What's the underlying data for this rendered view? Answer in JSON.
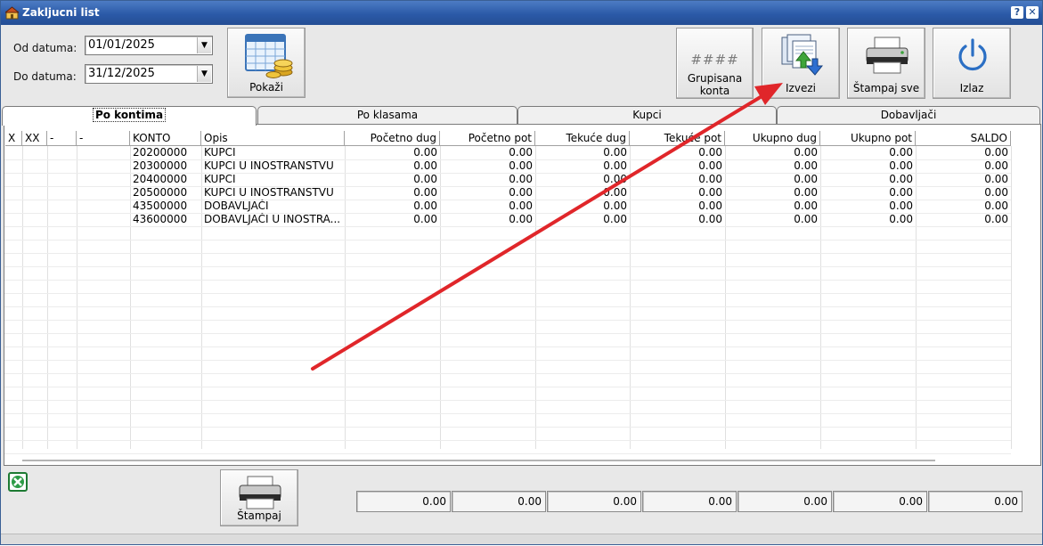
{
  "window": {
    "title": "Zakljucni list",
    "help_label": "?",
    "close_label": "✕"
  },
  "filters": {
    "from_label": "Od datuma:",
    "from_value": "01/01/2025",
    "to_label": "Do datuma:",
    "to_value": "31/12/2025"
  },
  "toolbar": {
    "show_label": "Pokaži",
    "grouped_symbol": "####",
    "grouped_label_1": "Grupisana",
    "grouped_label_2": "konta",
    "export_label": "Izvezi",
    "print_all_label": "Štampaj sve",
    "exit_label": "Izlaz"
  },
  "tabs": [
    "Po kontima",
    "Po klasama",
    "Kupci",
    "Dobavljači"
  ],
  "table": {
    "headers": [
      "X",
      "XX",
      "-",
      "-",
      "KONTO",
      "Opis",
      "Početno dug",
      "Početno pot",
      "Tekuće dug",
      "Tekuće pot",
      "Ukupno dug",
      "Ukupno pot",
      "SALDO"
    ],
    "rows": [
      {
        "konto": "20200000",
        "opis": "KUPCI",
        "values": [
          "0.00",
          "0.00",
          "0.00",
          "0.00",
          "0.00",
          "0.00",
          "0.00"
        ]
      },
      {
        "konto": "20300000",
        "opis": "KUPCI U INOSTRANSTVU",
        "values": [
          "0.00",
          "0.00",
          "0.00",
          "0.00",
          "0.00",
          "0.00",
          "0.00"
        ]
      },
      {
        "konto": "20400000",
        "opis": "KUPCI",
        "values": [
          "0.00",
          "0.00",
          "0.00",
          "0.00",
          "0.00",
          "0.00",
          "0.00"
        ]
      },
      {
        "konto": "20500000",
        "opis": "KUPCI U INOSTRANSTVU",
        "values": [
          "0.00",
          "0.00",
          "0.00",
          "0.00",
          "0.00",
          "0.00",
          "0.00"
        ]
      },
      {
        "konto": "43500000",
        "opis": "DOBAVLJAČI",
        "values": [
          "0.00",
          "0.00",
          "0.00",
          "0.00",
          "0.00",
          "0.00",
          "0.00"
        ]
      },
      {
        "konto": "43600000",
        "opis": "DOBAVLJAČI U INOSTRA...",
        "values": [
          "0.00",
          "0.00",
          "0.00",
          "0.00",
          "0.00",
          "0.00",
          "0.00"
        ]
      }
    ]
  },
  "footer": {
    "print_label": "Štampaj",
    "totals": [
      "0.00",
      "0.00",
      "0.00",
      "0.00",
      "0.00",
      "0.00",
      "0.00"
    ]
  },
  "annotation": {
    "arrow_color": "#e0262a"
  },
  "icons": {
    "app": "home-icon",
    "calendar": "calendar-coins-icon",
    "export": "export-files-icon",
    "printer": "printer-icon",
    "exit": "power-icon",
    "excel": "excel-icon"
  }
}
